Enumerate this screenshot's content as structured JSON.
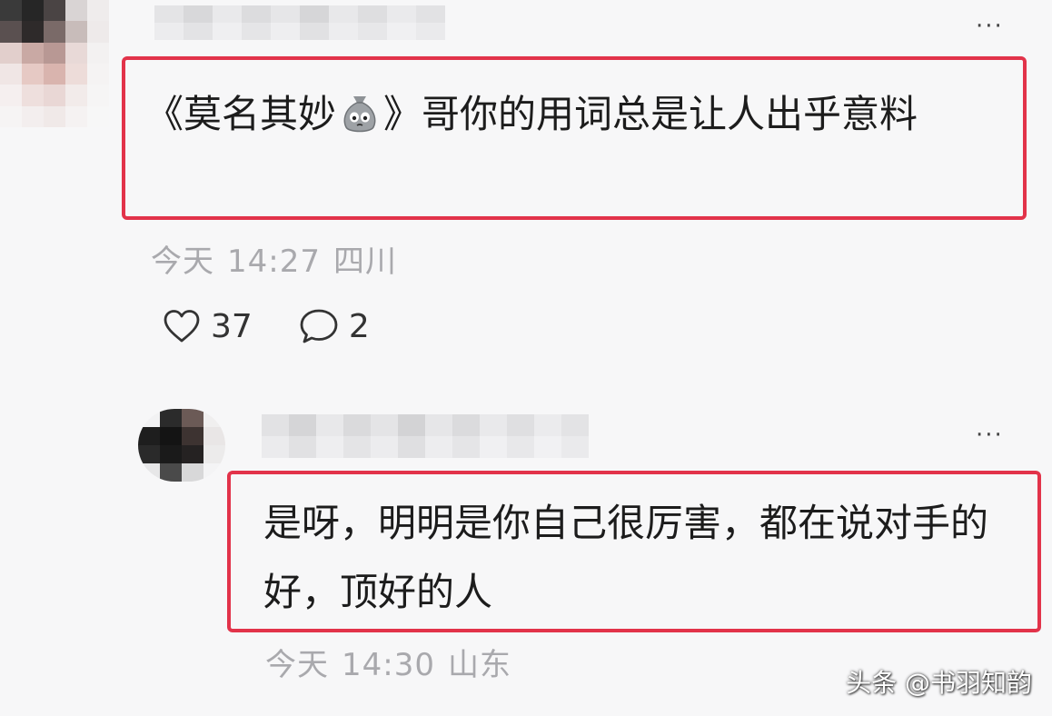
{
  "comments": [
    {
      "text_before": "《莫名其妙",
      "emoji": "bag-emoji",
      "text_after": "》哥你的用词总是让人出乎意料",
      "date": "今天",
      "time": "14:27",
      "location": "四川",
      "likes": "37",
      "replies": "2"
    },
    {
      "text": "是呀，明明是你自己很厉害，都在说对手的好，顶好的人",
      "date": "今天",
      "time": "14:30",
      "location": "山东"
    }
  ],
  "more_label": "···",
  "watermark": "头条 @书羽知韵",
  "colors": {
    "highlight_border": "#e2334a",
    "meta_text": "#a9a9ad",
    "background": "#f7f7f8"
  },
  "icons": [
    "more-icon",
    "heart-icon",
    "comment-icon",
    "bag-emoji"
  ]
}
